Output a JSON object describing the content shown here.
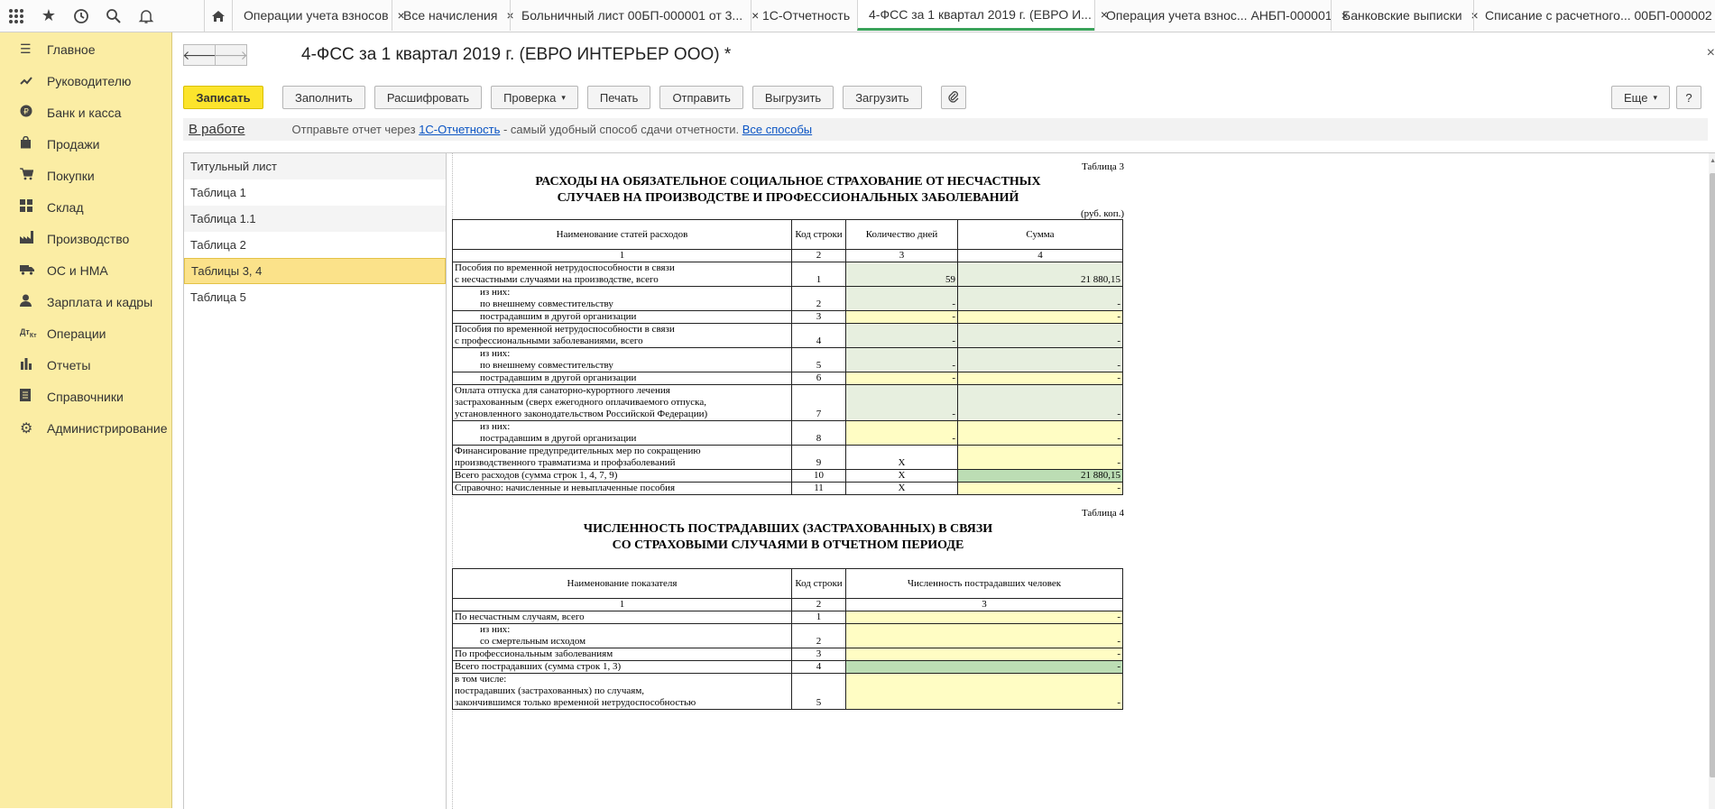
{
  "topbar": {
    "icons": [
      "apps-grid-icon",
      "star-icon",
      "history-icon",
      "search-icon",
      "bell-icon"
    ],
    "home_icon": "home-icon",
    "tabs": [
      {
        "label": "Операции учета взносов",
        "active": false
      },
      {
        "label": "Все начисления",
        "active": false
      },
      {
        "label": "Больничный лист 00БП-000001 от 3...",
        "active": false
      },
      {
        "label": "1С-Отчетность",
        "active": false
      },
      {
        "label": "4-ФСС за 1 квартал 2019 г. (ЕВРО И...",
        "active": true
      },
      {
        "label": "Операция учета взнос... АНБП-000001",
        "active": false
      },
      {
        "label": "Банковские выписки",
        "active": false
      },
      {
        "label": "Списание с расчетного... 00БП-000002",
        "active": false
      }
    ],
    "close_glyph": "×"
  },
  "sidebar": {
    "items": [
      {
        "label": "Главное",
        "icon": "menu-icon"
      },
      {
        "label": "Руководителю",
        "icon": "trend-icon"
      },
      {
        "label": "Банк и касса",
        "icon": "ruble-icon"
      },
      {
        "label": "Продажи",
        "icon": "bag-icon"
      },
      {
        "label": "Покупки",
        "icon": "cart-icon"
      },
      {
        "label": "Склад",
        "icon": "warehouse-icon"
      },
      {
        "label": "Производство",
        "icon": "factory-icon"
      },
      {
        "label": "ОС и НМА",
        "icon": "truck-icon"
      },
      {
        "label": "Зарплата и кадры",
        "icon": "person-icon"
      },
      {
        "label": "Операции",
        "icon": "operations-icon"
      },
      {
        "label": "Отчеты",
        "icon": "bar-chart-icon"
      },
      {
        "label": "Справочники",
        "icon": "book-icon"
      },
      {
        "label": "Администрирование",
        "icon": "gear-icon"
      }
    ]
  },
  "header": {
    "title": "4-ФСС за 1 квартал 2019 г. (ЕВРО ИНТЕРЬЕР ООО) *",
    "back_glyph": "🡐",
    "forward_glyph": "🡒",
    "close_glyph": "×"
  },
  "toolbar": {
    "save": "Записать",
    "fill": "Заполнить",
    "decode": "Расшифровать",
    "check": "Проверка",
    "print": "Печать",
    "send": "Отправить",
    "export": "Выгрузить",
    "import": "Загрузить",
    "attach_icon": "paperclip-icon",
    "more": "Еще",
    "help": "?",
    "dropdown_glyph": "▾"
  },
  "infobar": {
    "status": "В работе",
    "text_before": "Отправьте отчет через ",
    "link1": "1С-Отчетность",
    "text_after": " - самый удобный способ сдачи отчетности. ",
    "link2": "Все способы"
  },
  "sections": [
    {
      "label": "Титульный лист",
      "selected": false
    },
    {
      "label": "Таблица 1",
      "selected": false
    },
    {
      "label": "Таблица 1.1",
      "selected": false
    },
    {
      "label": "Таблица 2",
      "selected": false
    },
    {
      "label": "Таблицы 3, 4",
      "selected": true
    },
    {
      "label": "Таблица 5",
      "selected": false
    }
  ],
  "table3": {
    "caption": "Таблица 3",
    "title_line1": "РАСХОДЫ НА ОБЯЗАТЕЛЬНОЕ СОЦИАЛЬНОЕ СТРАХОВАНИЕ ОТ НЕСЧАСТНЫХ",
    "title_line2": "СЛУЧАЕВ НА ПРОИЗВОДСТВЕ И ПРОФЕССИОНАЛЬНЫХ ЗАБОЛЕВАНИЙ",
    "unit": "(руб. коп.)",
    "headers": [
      "Наименование статей расходов",
      "Код строки",
      "Количество дней",
      "Сумма"
    ],
    "col_numbers": [
      "1",
      "2",
      "3",
      "4"
    ],
    "rows": [
      {
        "lines": [
          "Пособия по временной нетрудоспособности в связи",
          "с несчастными случаями на производстве, всего"
        ],
        "code": "1",
        "days": "59",
        "sum": "21 880,15"
      },
      {
        "lines": [
          "из них:",
          "по внешнему совместительству"
        ],
        "code": "2",
        "days": "-",
        "sum": "-"
      },
      {
        "lines": [
          "пострадавшим в другой организации"
        ],
        "code": "3",
        "days": "-",
        "sum": "-"
      },
      {
        "lines": [
          "Пособия по временной нетрудоспособности в связи",
          "с профессиональными заболеваниями, всего"
        ],
        "code": "4",
        "days": "-",
        "sum": "-"
      },
      {
        "lines": [
          "из них:",
          "по внешнему совместительству"
        ],
        "code": "5",
        "days": "-",
        "sum": "-"
      },
      {
        "lines": [
          "пострадавшим в другой организации"
        ],
        "code": "6",
        "days": "-",
        "sum": "-"
      },
      {
        "lines": [
          "Оплата отпуска для санаторно-курортного лечения",
          "застрахованным (сверх ежегодного оплачиваемого отпуска,",
          "установленного законодательством Российской Федерации)"
        ],
        "code": "7",
        "days": "-",
        "sum": "-"
      },
      {
        "lines": [
          "из них:",
          "пострадавшим в другой организации"
        ],
        "code": "8",
        "days": "-",
        "sum": "-"
      },
      {
        "lines": [
          "Финансирование предупредительных мер по сокращению",
          "производственного травматизма и профзаболеваний"
        ],
        "code": "9",
        "days": "X",
        "sum": "-"
      },
      {
        "lines": [
          "Всего расходов (сумма строк 1, 4, 7, 9)"
        ],
        "code": "10",
        "days": "X",
        "sum": "21 880,15"
      },
      {
        "lines": [
          "Справочно: начисленные и невыплаченные пособия"
        ],
        "code": "11",
        "days": "X",
        "sum": "-"
      }
    ]
  },
  "table4": {
    "caption": "Таблица 4",
    "title_line1": "ЧИСЛЕННОСТЬ ПОСТРАДАВШИХ (ЗАСТРАХОВАННЫХ) В СВЯЗИ",
    "title_line2": "СО СТРАХОВЫМИ СЛУЧАЯМИ В ОТЧЕТНОМ ПЕРИОДЕ",
    "headers": [
      "Наименование показателя",
      "Код строки",
      "Численность пострадавших человек"
    ],
    "col_numbers": [
      "1",
      "2",
      "3"
    ],
    "rows": [
      {
        "lines": [
          "По несчастным случаям, всего"
        ],
        "code": "1",
        "value": "-"
      },
      {
        "lines": [
          "из них:",
          "со смертельным исходом"
        ],
        "code": "2",
        "value": "-"
      },
      {
        "lines": [
          "По профессиональным заболеваниям"
        ],
        "code": "3",
        "value": "-"
      },
      {
        "lines": [
          "Всего пострадавших (сумма строк 1, 3)"
        ],
        "code": "4",
        "value": "-"
      },
      {
        "lines": [
          "в том числе:",
          "пострадавших (застрахованных) по случаям,",
          "закончившимся только  временной  нетрудоспособностью"
        ],
        "code": "5",
        "value": "-"
      }
    ]
  }
}
